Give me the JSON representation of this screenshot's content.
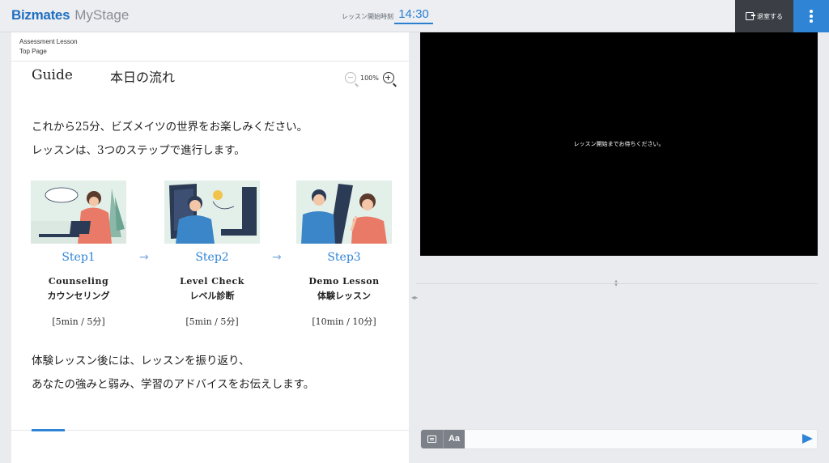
{
  "header": {
    "brand": "Bizmates",
    "product": "MyStage",
    "start_label": "レッスン開始時刻",
    "start_time": "14:30",
    "exit_label": "退室する",
    "menu_icon": "kebab-menu-icon"
  },
  "breadcrumb": {
    "line1": "Assessment Lesson",
    "line2": "Top Page"
  },
  "slide": {
    "title": "Guide",
    "subtitle": "本日の流れ",
    "zoom": "100%",
    "intro_line1": "これから25分、ビズメイツの世界をお楽しみください。",
    "intro_line2": "レッスンは、3つのステップで進行します。",
    "steps": [
      {
        "label": "Step1",
        "name_en": "Counseling",
        "name_jp": "カウンセリング",
        "duration": "[5min / 5分]"
      },
      {
        "label": "Step2",
        "name_en": "Level Check",
        "name_jp": "レベル診断",
        "duration": "[5min / 5分]"
      },
      {
        "label": "Step3",
        "name_en": "Demo Lesson",
        "name_jp": "体験レッスン",
        "duration": "[10min / 10分]"
      }
    ],
    "arrow": "→",
    "outro_line1": "体験レッスン後には、レッスンを振り返り、",
    "outro_line2": "あなたの強みと弱み、学習のアドバイスをお伝えします。"
  },
  "video": {
    "waiting_message": "レッスン開始までお待ちください。"
  },
  "chat": {
    "format_label": "Aa",
    "input_value": "",
    "accent": "#2f84d6"
  }
}
